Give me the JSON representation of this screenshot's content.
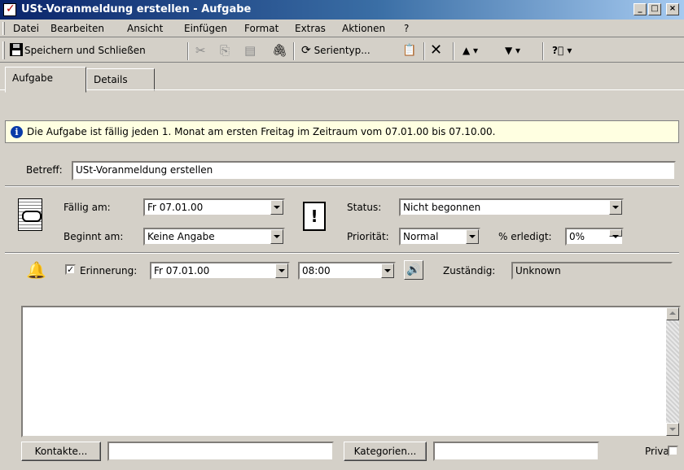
{
  "window": {
    "title": "USt-Voranmeldung erstellen - Aufgabe",
    "controls": [
      "_",
      "□",
      "×"
    ]
  },
  "menu": [
    "Datei",
    "Bearbeiten",
    "Ansicht",
    "Einfügen",
    "Format",
    "Extras",
    "Aktionen",
    "?"
  ],
  "toolbar": {
    "save_label": "Speichern und Schließen",
    "recurrence_label": "Serientyp...",
    "icons": [
      "floppy-icon",
      "cut-icon",
      "copy-icon",
      "paste-icon",
      "paperclip-icon",
      "recurrence-icon",
      "assign-icon",
      "delete-icon",
      "previous-icon",
      "next-icon",
      "help-icon"
    ]
  },
  "tabs": [
    "Aufgabe",
    "Details"
  ],
  "info": "Die Aufgabe ist fällig jeden 1. Monat am ersten Freitag im Zeitraum vom 07.01.00 bis 07.10.00.",
  "subject": {
    "label": "Betreff:",
    "value": "USt-Voranmeldung erstellen"
  },
  "due": {
    "label": "Fällig am:",
    "value": "Fr 07.01.00"
  },
  "start": {
    "label": "Beginnt am:",
    "value": "Keine Angabe"
  },
  "status": {
    "label": "Status:",
    "value": "Nicht begonnen"
  },
  "priority": {
    "label": "Priorität:",
    "value": "Normal"
  },
  "percent": {
    "label": "% erledigt:",
    "value": "0%"
  },
  "reminder": {
    "label": "Erinnerung:",
    "checked": true,
    "date": "Fr 07.01.00",
    "time": "08:00"
  },
  "owner": {
    "label": "Zuständig:",
    "value": "Unknown"
  },
  "notes": "",
  "footer": {
    "contacts_button": "Kontakte...",
    "categories_button": "Kategorien...",
    "private_label": "Privat"
  }
}
